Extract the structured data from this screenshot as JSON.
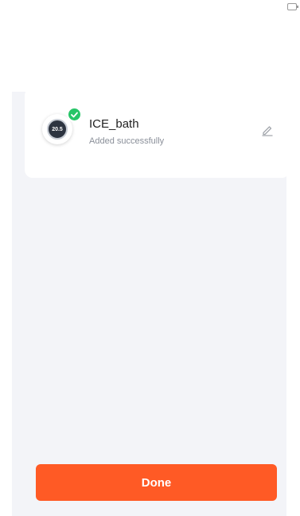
{
  "device": {
    "name": "ICE_bath",
    "status": "Added successfully",
    "thumbnail_temp": "20.5",
    "thumbnail_icon": "thermostat-icon",
    "badge_icon": "check-icon",
    "edit_icon": "pencil-icon"
  },
  "footer": {
    "done_label": "Done"
  },
  "colors": {
    "accent": "#ff5a25",
    "success": "#27c568",
    "background": "#f3f4f8"
  }
}
